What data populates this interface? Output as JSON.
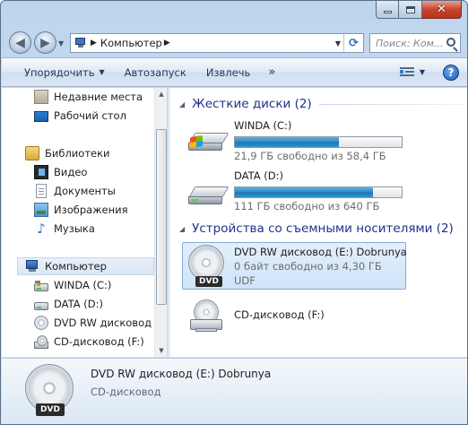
{
  "address": {
    "location": "Компьютер"
  },
  "search": {
    "placeholder": "Поиск: Ком..."
  },
  "toolbar": {
    "organize": "Упорядочить",
    "autoplay": "Автозапуск",
    "eject": "Извлечь",
    "more": "»"
  },
  "navpane": {
    "items": [
      {
        "label": "Недавние места",
        "icon": "recent-places-icon"
      },
      {
        "label": "Рабочий стол",
        "icon": "desktop-icon"
      },
      {
        "label": "Библиотеки",
        "icon": "libraries-icon"
      },
      {
        "label": "Видео",
        "icon": "video-library-icon"
      },
      {
        "label": "Документы",
        "icon": "documents-library-icon"
      },
      {
        "label": "Изображения",
        "icon": "pictures-library-icon"
      },
      {
        "label": "Музыка",
        "icon": "music-library-icon"
      },
      {
        "label": "Компьютер",
        "icon": "computer-icon"
      },
      {
        "label": "WINDA (C:)",
        "icon": "system-drive-icon"
      },
      {
        "label": "DATA (D:)",
        "icon": "hard-drive-icon"
      },
      {
        "label": "DVD RW дисковод (E",
        "icon": "dvd-drive-icon"
      },
      {
        "label": "CD-дисковод (F:)",
        "icon": "cd-drive-icon"
      }
    ]
  },
  "content": {
    "hard_disks": {
      "header": "Жесткие диски (2)",
      "drives": [
        {
          "name": "WINDA (C:)",
          "free_text": "21,9 ГБ свободно из 58,4 ГБ",
          "used_fraction": 0.625
        },
        {
          "name": "DATA (D:)",
          "free_text": "111 ГБ свободно из 640 ГБ",
          "used_fraction": 0.827
        }
      ]
    },
    "removable": {
      "header": "Устройства со съемными носителями (2)",
      "drives": [
        {
          "name": "DVD RW дисковод (E:) Dobrunya",
          "free_text": "0 байт свободно из 4,30 ГБ",
          "filesystem": "UDF",
          "badge": "DVD"
        },
        {
          "name": "CD-дисковод (F:)"
        }
      ]
    }
  },
  "details": {
    "name": "DVD RW дисковод (E:) Dobrunya",
    "type": "CD-дисковод",
    "badge": "DVD"
  },
  "colors": {
    "bar_fill": "#2c86c4",
    "group_header": "#1e3287",
    "selection": "#cfe3f8"
  }
}
